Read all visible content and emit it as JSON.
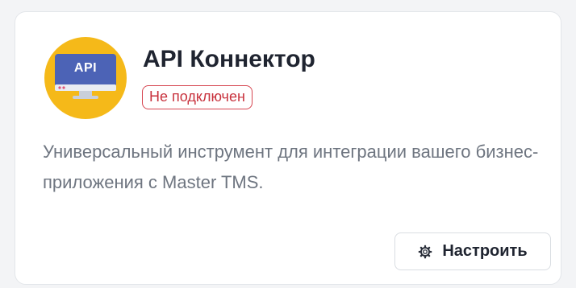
{
  "card": {
    "title": "API Коннектор",
    "status": "Не подключен",
    "description": "Универсальный инструмент для интеграции вашего бизнес-приложения с Master TMS.",
    "logo": {
      "text": "API",
      "icon": "monitor-icon",
      "background_color": "#f5b919",
      "screen_color": "#4c63b6"
    },
    "setup_button": {
      "label": "Настроить",
      "icon": "gear-icon"
    }
  },
  "colors": {
    "status_border": "#d64550",
    "status_text": "#c8323d",
    "title": "#1f2430",
    "description": "#6e7580"
  }
}
